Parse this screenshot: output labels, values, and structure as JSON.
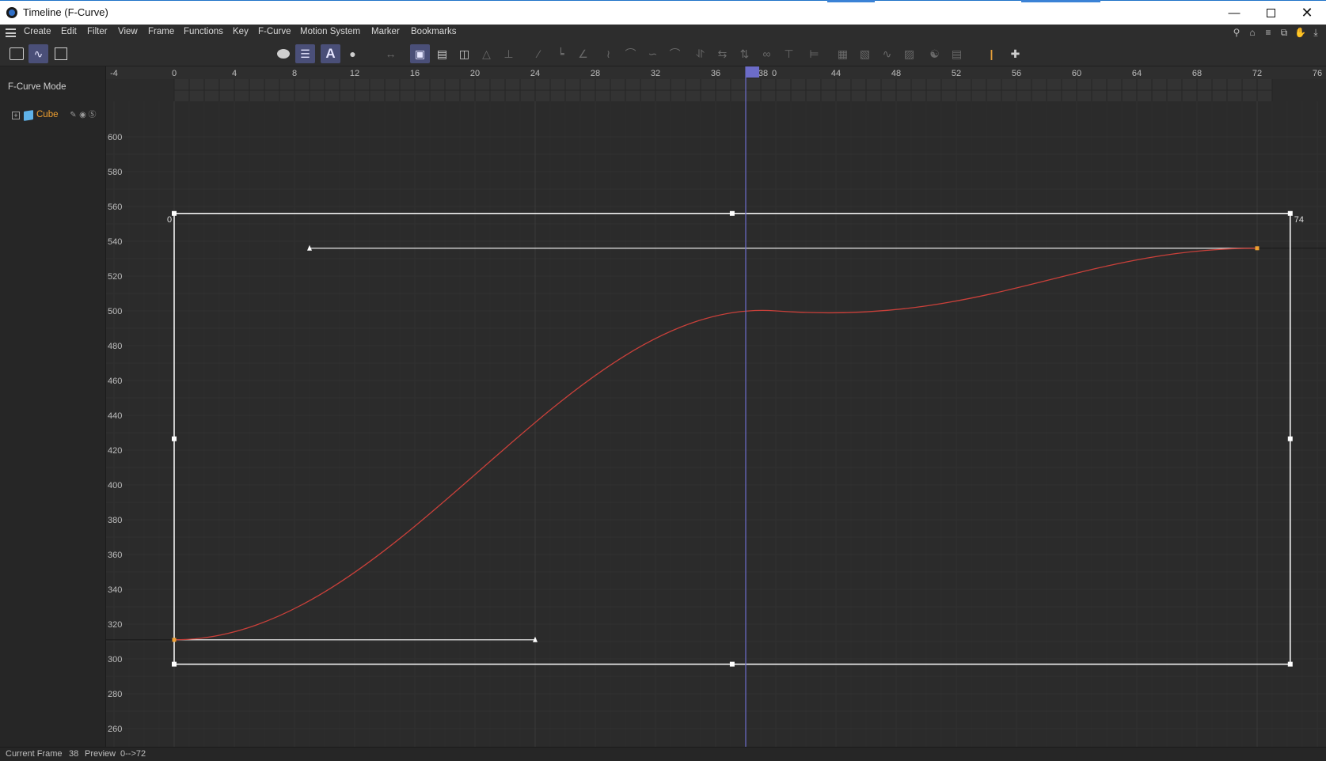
{
  "window": {
    "title": "Timeline (F-Curve)",
    "minimize_icon": "minimize-icon",
    "maximize_icon": "maximize-icon",
    "close_icon": "close-icon"
  },
  "menu": {
    "items": [
      "Create",
      "Edit",
      "Filter",
      "View",
      "Frame",
      "Functions",
      "Key",
      "F-Curve",
      "Motion System",
      "Marker",
      "Bookmarks"
    ],
    "right_icons": [
      "search-icon",
      "home-icon",
      "filter-icon",
      "new-window-icon",
      "hand-icon",
      "pin-icon"
    ]
  },
  "left_panel": {
    "mode_label": "F-Curve Mode",
    "object_name": "Cube"
  },
  "timeline": {
    "current_frame": 38,
    "ruler_labels": [
      "-4",
      "0",
      "4",
      "8",
      "12",
      "16",
      "20",
      "24",
      "28",
      "32",
      "36",
      "38",
      "0",
      "44",
      "48",
      "52",
      "56",
      "60",
      "64",
      "68",
      "72",
      "76"
    ],
    "value_labels": [
      "600",
      "580",
      "560",
      "540",
      "520",
      "500",
      "480",
      "460",
      "440",
      "420",
      "400",
      "380",
      "360",
      "340",
      "320",
      "300",
      "280",
      "260"
    ],
    "selection_start_label": "0",
    "selection_end_label": "74"
  },
  "curve": {
    "color": "#c9403a",
    "keyframes": [
      {
        "frame": 0,
        "value": 311
      },
      {
        "frame": 72,
        "value": 536
      }
    ]
  },
  "status": {
    "current_frame_label": "Current Frame",
    "current_frame_value": "38",
    "preview_label": "Preview",
    "preview_range": "0-->72"
  },
  "colors": {
    "playhead": "#6c6cc8",
    "selection_box": "#ffffff",
    "key_marker": "#f0a030"
  }
}
